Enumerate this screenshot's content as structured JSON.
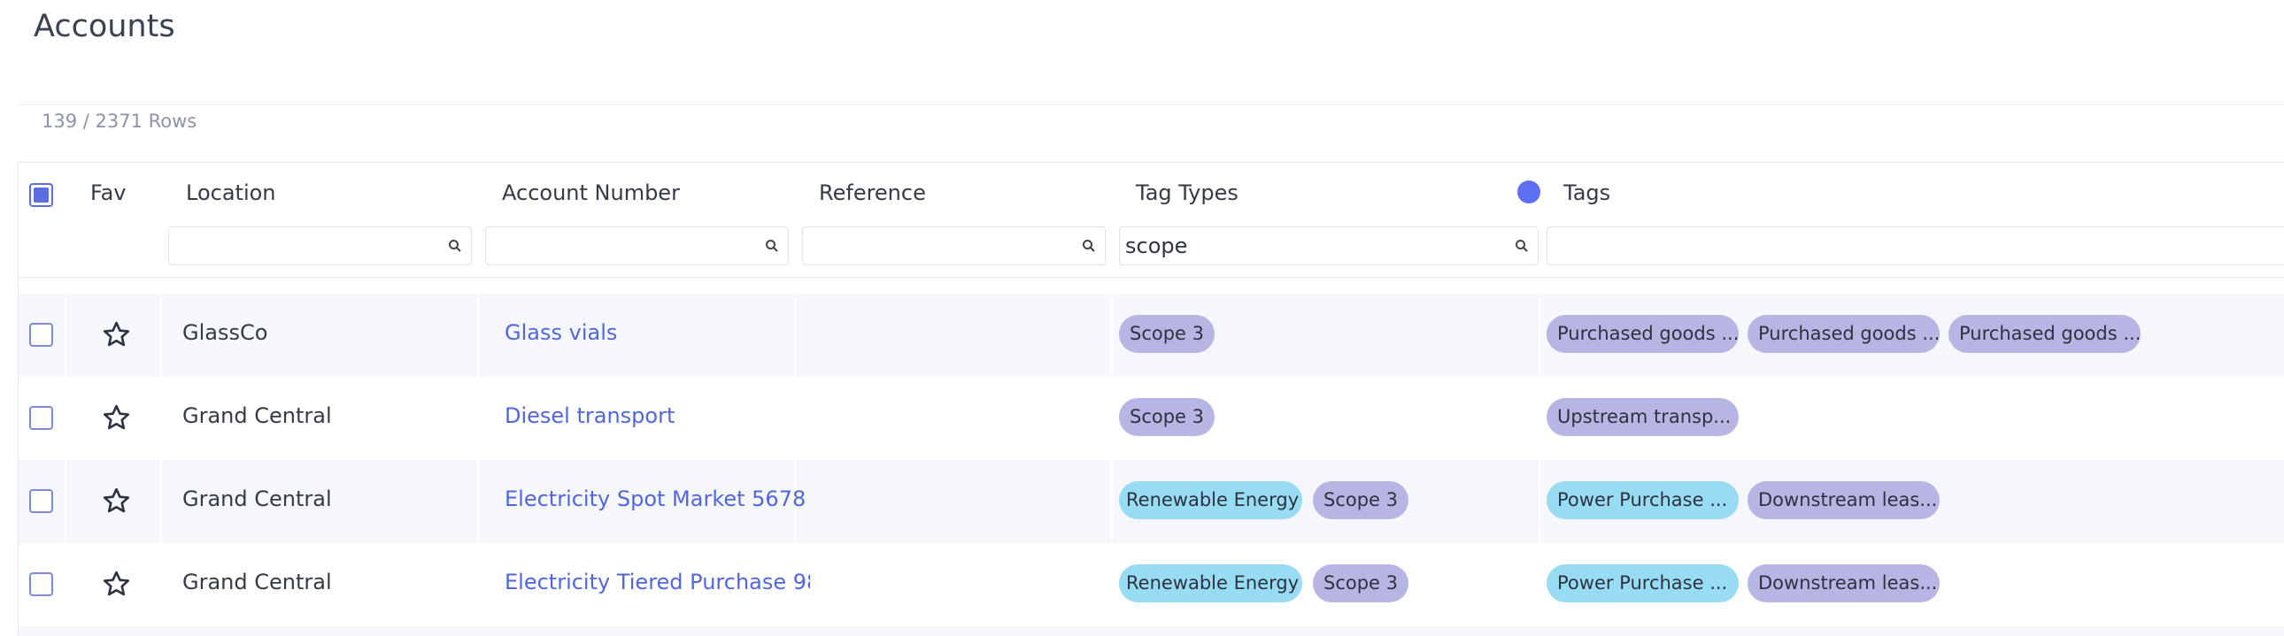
{
  "page": {
    "title": "Accounts",
    "row_count": "139 / 2371 Rows"
  },
  "columns": {
    "fav": "Fav",
    "location": "Location",
    "account_number": "Account Number",
    "reference": "Reference",
    "tag_types": "Tag Types",
    "tags": "Tags"
  },
  "filters": {
    "location": "",
    "account_number": "",
    "reference": "",
    "tag_types": "scope",
    "tags": ""
  },
  "colors": {
    "accent": "#5b6ff0",
    "tag_purple": "#b6b5e4",
    "tag_blue": "#97dcf2",
    "link": "#5166dd"
  },
  "rows": [
    {
      "location": "GlassCo",
      "account": "Glass vials",
      "reference": "",
      "tag_types": [
        "Scope 3"
      ],
      "tags": [
        "Purchased goods ...",
        "Purchased goods ...",
        "Purchased goods ..."
      ]
    },
    {
      "location": "Grand Central",
      "account": "Diesel transport",
      "reference": "",
      "tag_types": [
        "Scope 3"
      ],
      "tags": [
        "Upstream transp..."
      ]
    },
    {
      "location": "Grand Central",
      "account": "Electricity Spot Market 5678",
      "reference": "",
      "tag_types": [
        "Renewable Energy",
        "Scope 3"
      ],
      "tags": [
        "Power Purchase ...",
        "Downstream leas..."
      ]
    },
    {
      "location": "Grand Central",
      "account": "Electricity Tiered Purchase 98",
      "reference": "",
      "tag_types": [
        "Renewable Energy",
        "Scope 3"
      ],
      "tags": [
        "Power Purchase ...",
        "Downstream leas..."
      ]
    }
  ]
}
